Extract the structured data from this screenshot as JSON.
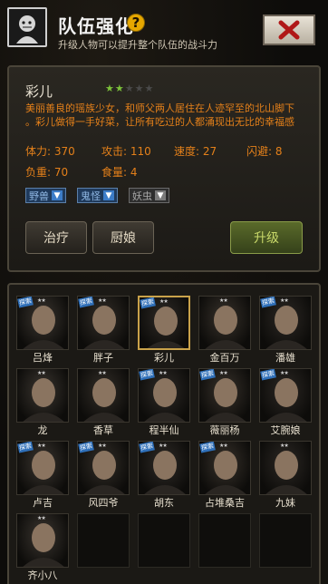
{
  "header": {
    "title": "队伍强化",
    "help_icon": "?",
    "subtitle": "升级人物可以提升整个队伍的战斗力",
    "close_label": "close-icon"
  },
  "detail": {
    "name": "彩儿",
    "stars_filled": 2,
    "stars_total": 5,
    "description_lines": [
      "美丽善良的瑶族少女，和师父两人居住在人迹罕至的北山脚下",
      "。彩儿做得一手好菜，让所有吃过的人都涌现出无比的幸福感"
    ],
    "stats": {
      "hp": "体力: 370",
      "attack": "攻击: 110",
      "speed": "速度: 27",
      "dodge": "闪避: 8",
      "load": "负重: 70",
      "food": "食量: 4"
    },
    "tags": [
      {
        "label": "野兽",
        "state": "active"
      },
      {
        "label": "鬼怪",
        "state": "active"
      },
      {
        "label": "妖虫",
        "state": "inactive"
      }
    ],
    "buttons": {
      "heal": "治疗",
      "cook": "厨娘",
      "upgrade": "升级"
    }
  },
  "roster": [
    {
      "name": "吕烽",
      "badge": "探索",
      "stars": "★★"
    },
    {
      "name": "胖子",
      "badge": "探索",
      "stars": "★★"
    },
    {
      "name": "彩儿",
      "badge": "探索",
      "stars": "★★",
      "selected": true
    },
    {
      "name": "金百万",
      "badge": "",
      "stars": "★★"
    },
    {
      "name": "潘雄",
      "badge": "探索",
      "stars": "★★"
    },
    {
      "name": "龙",
      "badge": "",
      "stars": "★★"
    },
    {
      "name": "香草",
      "badge": "",
      "stars": "★★"
    },
    {
      "name": "程半仙",
      "badge": "探索",
      "stars": "★★"
    },
    {
      "name": "薇丽杨",
      "badge": "探索",
      "stars": "★★"
    },
    {
      "name": "艾腕娘",
      "badge": "探索",
      "stars": "★★"
    },
    {
      "name": "卢吉",
      "badge": "探索",
      "stars": "★★"
    },
    {
      "name": "风四爷",
      "badge": "探索",
      "stars": "★★"
    },
    {
      "name": "胡东",
      "badge": "探索",
      "stars": "★★"
    },
    {
      "name": "占堆桑吉",
      "badge": "探索",
      "stars": "★★"
    },
    {
      "name": "九妹",
      "badge": "",
      "stars": "★★"
    },
    {
      "name": "齐小八",
      "badge": "",
      "stars": "★★"
    }
  ],
  "colors": {
    "accent_orange": "#e4801a",
    "star_green": "#7cc23a",
    "selected_border": "#c9a24a"
  }
}
